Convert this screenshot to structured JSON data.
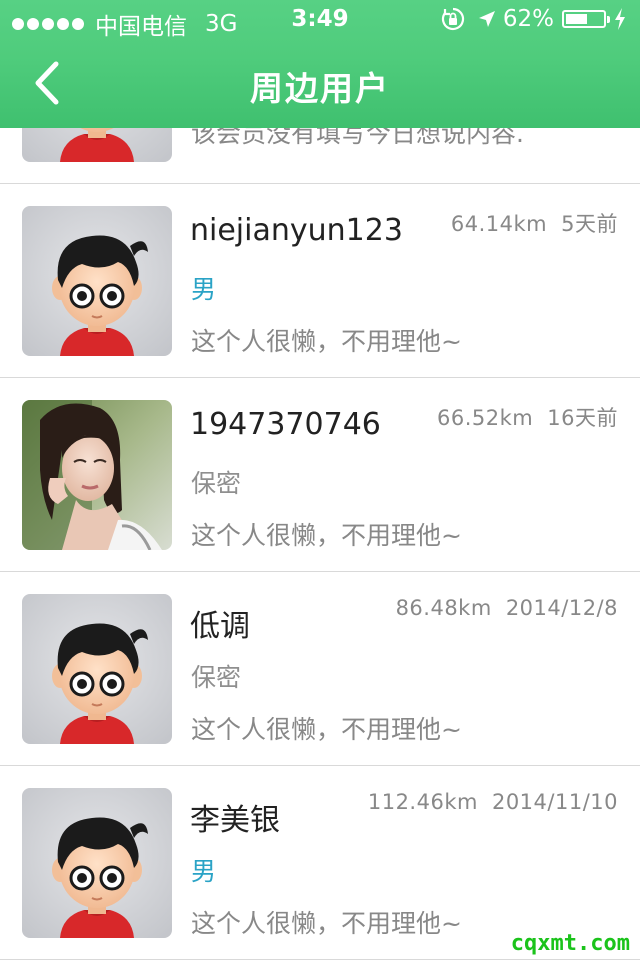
{
  "status_bar": {
    "carrier": "中国电信",
    "network": "3G",
    "time": "3:49",
    "battery_percent_text": "62%",
    "battery_level": 0.62,
    "icons": [
      "orientation-lock-icon",
      "location-arrow-icon",
      "charging-bolt-icon"
    ]
  },
  "nav": {
    "title": "周边用户",
    "back_icon": "chevron-left-icon"
  },
  "colors": {
    "nav_green": "#4fcc7c",
    "male_blue": "#2aa3c6",
    "gray_text": "#888888"
  },
  "users": [
    {
      "username": "",
      "distance": "",
      "time_ago": "",
      "gender": "",
      "bio": "该会员没有填写今日想说内容.",
      "avatar": "cartoon-boy"
    },
    {
      "username": "niejianyun123",
      "distance": "64.14km",
      "time_ago": "5天前",
      "gender": "男",
      "bio": "这个人很懒，不用理他~",
      "avatar": "cartoon-boy"
    },
    {
      "username": "1947370746",
      "distance": "66.52km",
      "time_ago": "16天前",
      "gender": "保密",
      "bio": "这个人很懒，不用理他~",
      "avatar": "photo"
    },
    {
      "username": "低调",
      "distance": "86.48km",
      "time_ago": "2014/12/8",
      "gender": "保密",
      "bio": "这个人很懒，不用理他~",
      "avatar": "cartoon-boy"
    },
    {
      "username": "李美银",
      "distance": "112.46km",
      "time_ago": "2014/11/10",
      "gender": "男",
      "bio": "这个人很懒，不用理他~",
      "avatar": "cartoon-boy"
    }
  ],
  "watermark": "cqxmt.com"
}
